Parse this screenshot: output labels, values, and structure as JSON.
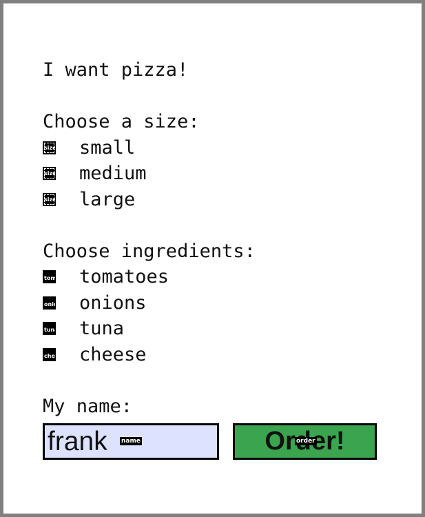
{
  "form": {
    "heading": "I want pizza!",
    "size_section": {
      "label": "Choose a size:",
      "options": [
        {
          "box_label": "size",
          "label": "small"
        },
        {
          "box_label": "size",
          "label": "medium"
        },
        {
          "box_label": "size",
          "label": "large"
        }
      ]
    },
    "ingredients_section": {
      "label": "Choose ingredients:",
      "options": [
        {
          "box_label": "tomatoes",
          "label": "tomatoes"
        },
        {
          "box_label": "onions",
          "label": "onions"
        },
        {
          "box_label": "tuna",
          "label": "tuna"
        },
        {
          "box_label": "cheese",
          "label": "cheese"
        }
      ]
    },
    "name_section": {
      "label": "My name:",
      "value": "frank",
      "field_tag": "name"
    },
    "order_button": {
      "label": "Order!",
      "tag": "order"
    }
  },
  "colors": {
    "name_field_background": "#dde3ff",
    "order_button_background": "#3aa54e",
    "page_border": "#808080"
  }
}
